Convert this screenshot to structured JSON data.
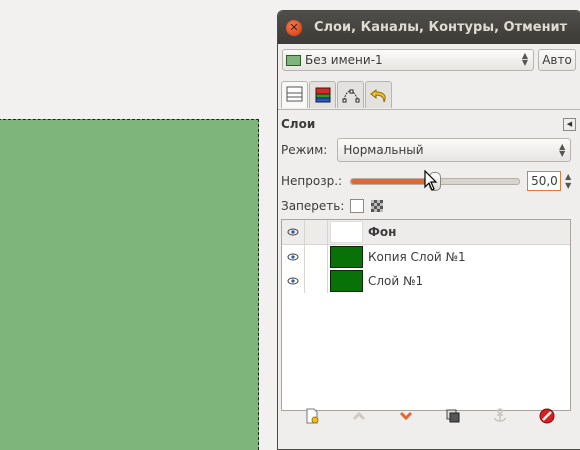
{
  "dialog": {
    "title": "Слои, Каналы, Контуры, Отменит",
    "image_selector": "Без имени-1",
    "auto_button": "Авто",
    "tabs": [
      "layers-tab",
      "channels-tab",
      "paths-tab",
      "undo-history-tab"
    ]
  },
  "layers_panel": {
    "title": "Слои",
    "mode_label": "Режим:",
    "mode_value": "Нормальный",
    "opacity_label": "Непрозр.:",
    "opacity_value": "50,0",
    "opacity_fraction": 0.5,
    "lock_label": "Запереть:"
  },
  "layers": [
    {
      "name": "Фон",
      "visible": true,
      "thumb": "white",
      "active": true
    },
    {
      "name": "Копия Слой №1",
      "visible": true,
      "thumb": "green",
      "active": false
    },
    {
      "name": "Слой №1",
      "visible": true,
      "thumb": "green",
      "active": false
    }
  ],
  "toolbar": [
    "new-layer-icon",
    "raise-layer-icon",
    "lower-layer-icon",
    "duplicate-layer-icon",
    "anchor-layer-icon",
    "delete-layer-icon"
  ],
  "colors": {
    "canvas_fill": "#7db57a",
    "layer_thumb": "#087208",
    "accent": "#e5672f"
  }
}
